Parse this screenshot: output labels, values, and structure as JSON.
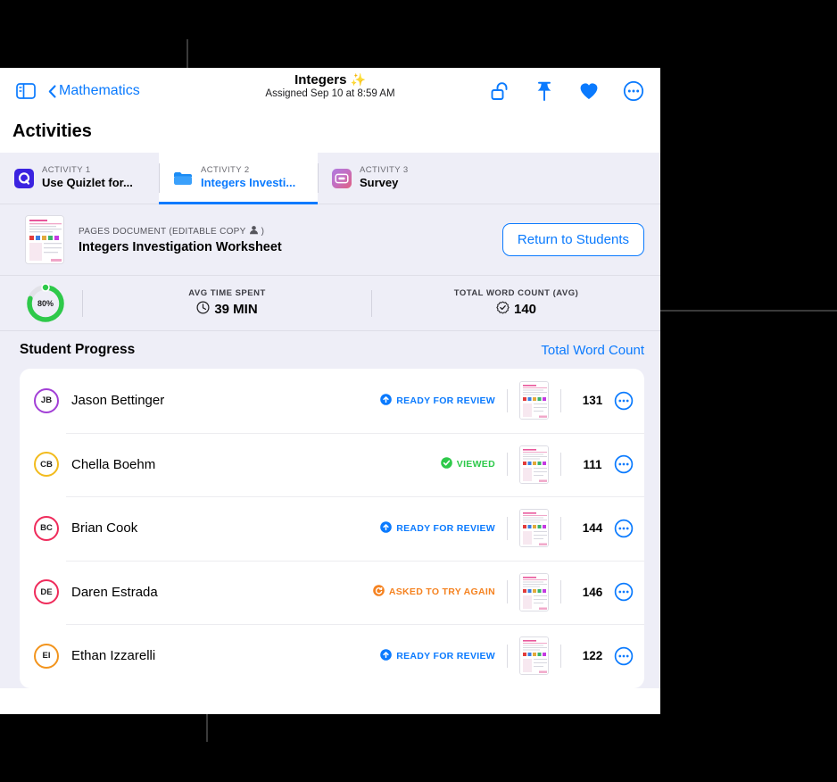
{
  "toolbar": {
    "sidebar_icon": "sidebar-toggle-icon",
    "back_label": "Mathematics",
    "title": "Integers",
    "title_emoji": "✨",
    "subtitle": "Assigned Sep 10 at 8:59 AM",
    "actions": [
      {
        "name": "unlock-icon",
        "label": "Unlock"
      },
      {
        "name": "pin-icon",
        "label": "Pin"
      },
      {
        "name": "heart-icon",
        "label": "Favorite"
      },
      {
        "name": "more-circle-icon",
        "label": "More"
      }
    ]
  },
  "page": {
    "title": "Activities"
  },
  "tabs": [
    {
      "kicker": "ACTIVITY 1",
      "name": "Use Quizlet for...",
      "icon": "quizlet-icon",
      "active": false
    },
    {
      "kicker": "ACTIVITY 2",
      "name": "Integers Investi...",
      "icon": "pages-document-icon",
      "active": true
    },
    {
      "kicker": "ACTIVITY 3",
      "name": "Survey",
      "icon": "survey-icon",
      "active": false
    }
  ],
  "document": {
    "kicker": "PAGES DOCUMENT (EDITABLE COPY",
    "kicker_suffix": ")",
    "person_icon": "person-icon",
    "name": "Integers Investigation Worksheet",
    "return_button": "Return to Students"
  },
  "stats": {
    "ring_percent": "80%",
    "ring_value": 80,
    "ring_color": "#2ec94a",
    "items": [
      {
        "label": "AVG TIME SPENT",
        "value": "39 MIN",
        "icon": "clock-icon"
      },
      {
        "label": "TOTAL WORD COUNT (AVG)",
        "value": "140",
        "icon": "seal-checkmark-icon"
      }
    ]
  },
  "progress": {
    "title": "Student Progress",
    "link": "Total Word Count"
  },
  "students": [
    {
      "initials": "JB",
      "name": "Jason Bettinger",
      "ring_color": "#a23fd6",
      "status": "READY FOR REVIEW",
      "status_color": "#0a7afe",
      "status_icon": "upload-circle-icon",
      "word_count": "131"
    },
    {
      "initials": "CB",
      "name": "Chella Boehm",
      "ring_color": "#f2bb1d",
      "status": "VIEWED",
      "status_color": "#2ec94a",
      "status_icon": "check-circle-icon",
      "word_count": "111"
    },
    {
      "initials": "BC",
      "name": "Brian Cook",
      "ring_color": "#ef2b5b",
      "status": "READY FOR REVIEW",
      "status_color": "#0a7afe",
      "status_icon": "upload-circle-icon",
      "word_count": "144"
    },
    {
      "initials": "DE",
      "name": "Daren Estrada",
      "ring_color": "#ef2b5b",
      "status": "ASKED TO TRY AGAIN",
      "status_color": "#f58220",
      "status_icon": "retry-circle-icon",
      "word_count": "146"
    },
    {
      "initials": "EI",
      "name": "Ethan Izzarelli",
      "ring_color": "#f2941d",
      "status": "READY FOR REVIEW",
      "status_color": "#0a7afe",
      "status_icon": "upload-circle-icon",
      "word_count": "122"
    }
  ],
  "colors": {
    "accent": "#0a7afe",
    "panel_bg": "#eeeef7",
    "page_bg": "#000000",
    "green": "#2ec94a",
    "orange": "#f58220"
  }
}
